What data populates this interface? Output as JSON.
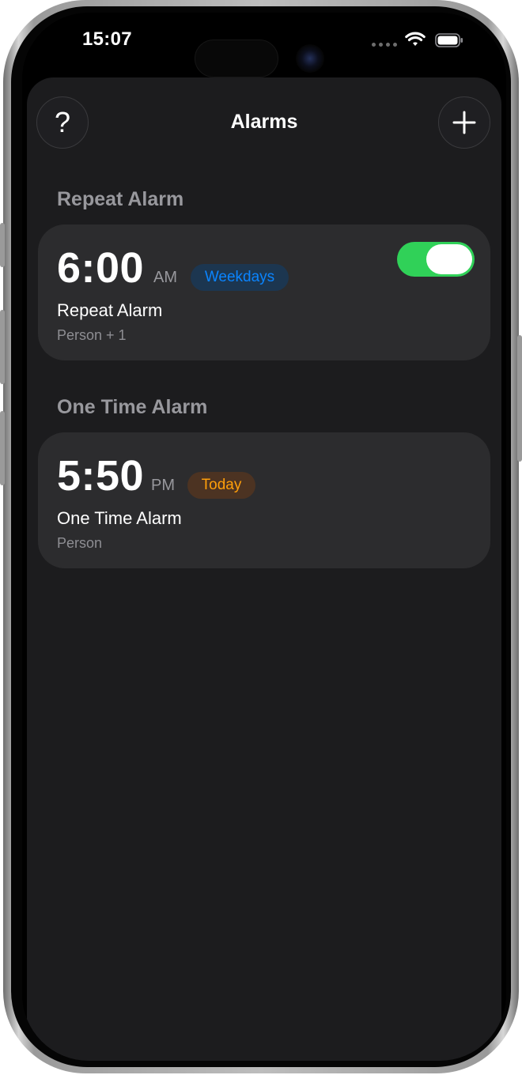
{
  "status_bar": {
    "time": "15:07",
    "icons": [
      "signal-dots-icon",
      "wifi-icon",
      "battery-icon"
    ]
  },
  "nav": {
    "title": "Alarms",
    "help_icon": "question-mark-icon",
    "help_glyph": "?",
    "add_icon": "plus-icon"
  },
  "sections": [
    {
      "title": "Repeat Alarm",
      "alarm": {
        "time": "6:00",
        "period": "AM",
        "badge": "Weekdays",
        "name": "Repeat Alarm",
        "people": "Person + 1",
        "enabled": true
      }
    },
    {
      "title": "One Time Alarm",
      "alarm": {
        "time": "5:50",
        "period": "PM",
        "badge": "Today",
        "name": "One Time Alarm",
        "people": "Person"
      }
    }
  ],
  "colors": {
    "accent_green": "#30d158",
    "badge_blue": "#0a84ff",
    "badge_orange": "#ff9f0a",
    "background": "#1c1c1e",
    "card": "#2c2c2e"
  }
}
